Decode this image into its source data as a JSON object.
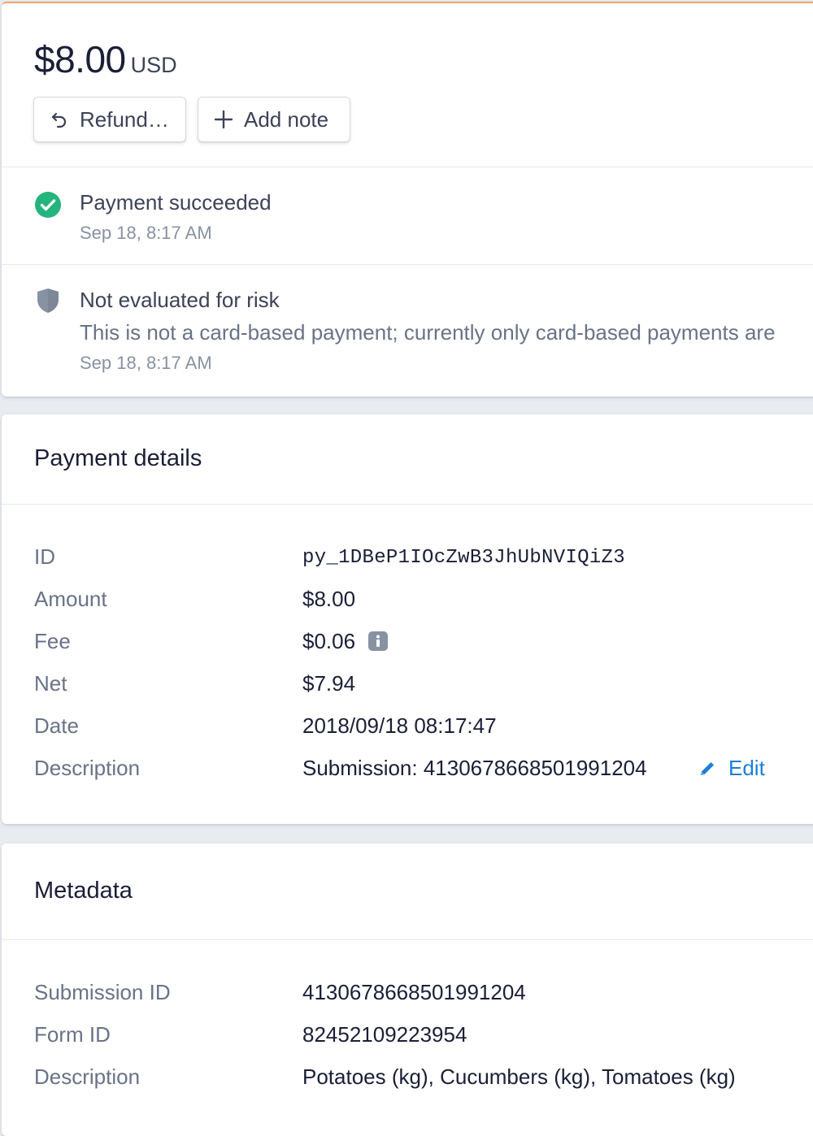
{
  "summary": {
    "amount": "$8.00",
    "currency": "USD",
    "actions": {
      "refund_label": "Refund…",
      "add_note_label": "Add note"
    },
    "accent_color": "#f5a06a"
  },
  "timeline": [
    {
      "icon": "check-circle-icon",
      "status_color": "#24b47e",
      "title": "Payment succeeded",
      "time": "Sep 18, 8:17 AM"
    },
    {
      "icon": "shield-icon",
      "status_color": "#8792a2",
      "title": "Not evaluated for risk",
      "description": "This is not a card-based payment; currently only card-based payments are",
      "time": "Sep 18, 8:17 AM"
    }
  ],
  "payment_details": {
    "title": "Payment details",
    "rows": [
      {
        "label": "ID",
        "value": "py_1DBeP1IOcZwB3JhUbNVIQiZ3"
      },
      {
        "label": "Amount",
        "value": "$8.00"
      },
      {
        "label": "Fee",
        "value": "$0.06",
        "icon": "info-icon"
      },
      {
        "label": "Net",
        "value": "$7.94"
      },
      {
        "label": "Date",
        "value": "2018/09/18 08:17:47"
      },
      {
        "label": "Description",
        "value": "Submission: 4130678668501991204"
      }
    ],
    "edit_label": "Edit",
    "link_color": "#1c7ed6"
  },
  "metadata": {
    "title": "Metadata",
    "rows": [
      {
        "label": "Submission ID",
        "value": "4130678668501991204"
      },
      {
        "label": "Form ID",
        "value": "82452109223954"
      },
      {
        "label": "Description",
        "value": "Potatoes (kg), Cucumbers (kg), Tomatoes (kg)"
      }
    ]
  }
}
